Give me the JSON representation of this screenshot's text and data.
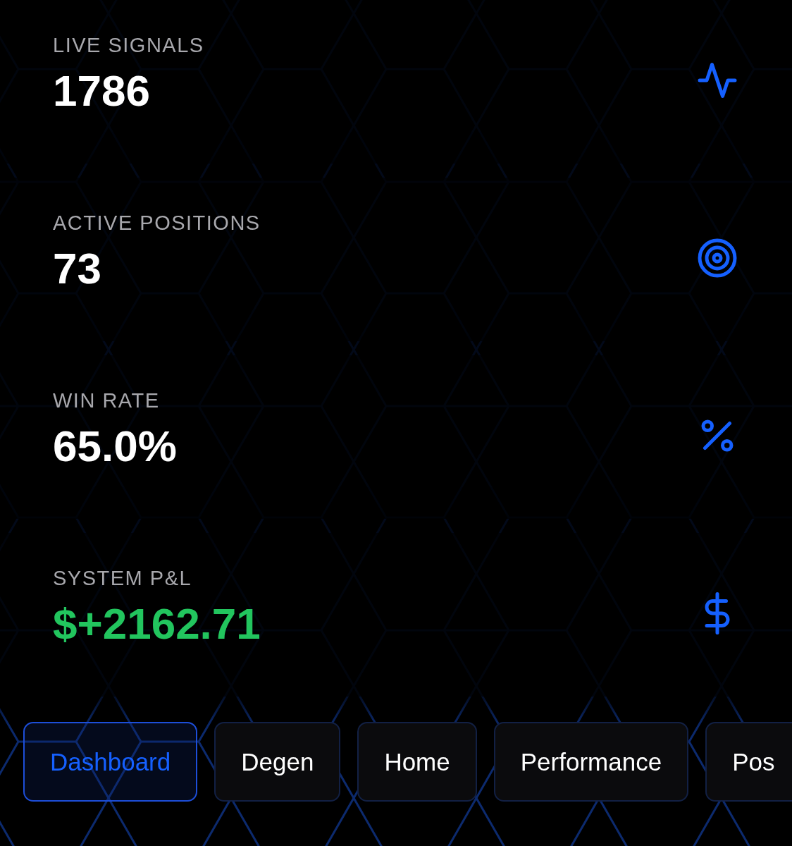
{
  "stats": [
    {
      "label": "LIVE SIGNALS",
      "value": "1786",
      "positive": false
    },
    {
      "label": "ACTIVE POSITIONS",
      "value": "73",
      "positive": false
    },
    {
      "label": "WIN RATE",
      "value": "65.0%",
      "positive": false
    },
    {
      "label": "SYSTEM P&L",
      "value": "$+2162.71",
      "positive": true
    }
  ],
  "nav_tabs": [
    {
      "label": "Dashboard",
      "selected": true
    },
    {
      "label": "Degen",
      "selected": false
    },
    {
      "label": "Home",
      "selected": false
    },
    {
      "label": "Performance",
      "selected": false
    },
    {
      "label": "Pos",
      "selected": false
    }
  ]
}
